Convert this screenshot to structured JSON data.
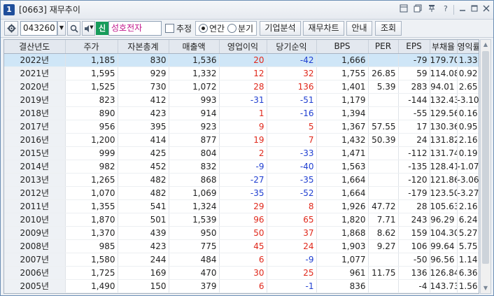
{
  "window": {
    "number": "1",
    "title": "[0663] 재무추이"
  },
  "titlebar_icons": [
    "restore-icon",
    "copy-icon",
    "pin-icon",
    "help-icon",
    "minimize-icon",
    "maximize-icon",
    "close-icon"
  ],
  "toolbar": {
    "code": "043260",
    "market_badge": "신",
    "company_name": "성호전자",
    "estimate_label": "추정",
    "estimate_checked": false,
    "annual_label": "연간",
    "quarter_label": "분기",
    "period_selected": "연간",
    "btn_company_analysis": "기업분석",
    "btn_financial_chart": "재무차트",
    "btn_guide": "안내",
    "btn_search": "조회"
  },
  "table": {
    "headers": [
      "결산년도",
      "주가",
      "자본총계",
      "매출액",
      "영업이익",
      "당기순익",
      "BPS",
      "PER",
      "EPS",
      "부채율",
      "영익률"
    ],
    "selected_row": 0,
    "rows": [
      [
        "2022년",
        "1,185",
        "830",
        "1,536",
        "20",
        "-42",
        "1,666",
        "",
        "-79",
        "179.70",
        "1.33"
      ],
      [
        "2021년",
        "1,595",
        "929",
        "1,332",
        "12",
        "32",
        "1,755",
        "26.85",
        "59",
        "114.08",
        "0.92"
      ],
      [
        "2020년",
        "1,525",
        "730",
        "1,072",
        "28",
        "136",
        "1,401",
        "5.39",
        "283",
        "94.01",
        "2.65"
      ],
      [
        "2019년",
        "823",
        "412",
        "993",
        "-31",
        "-51",
        "1,179",
        "",
        "-144",
        "132.43",
        "-3.10"
      ],
      [
        "2018년",
        "890",
        "423",
        "914",
        "1",
        "-16",
        "1,394",
        "",
        "-55",
        "129.56",
        "0.16"
      ],
      [
        "2017년",
        "956",
        "395",
        "923",
        "9",
        "5",
        "1,367",
        "57.55",
        "17",
        "130.36",
        "0.95"
      ],
      [
        "2016년",
        "1,200",
        "414",
        "877",
        "19",
        "7",
        "1,432",
        "50.39",
        "24",
        "131.82",
        "2.16"
      ],
      [
        "2015년",
        "999",
        "425",
        "804",
        "2",
        "-33",
        "1,471",
        "",
        "-112",
        "131.74",
        "0.19"
      ],
      [
        "2014년",
        "982",
        "452",
        "832",
        "-9",
        "-40",
        "1,563",
        "",
        "-135",
        "128.41",
        "-1.07"
      ],
      [
        "2013년",
        "1,265",
        "482",
        "868",
        "-27",
        "-35",
        "1,664",
        "",
        "-120",
        "121.86",
        "-3.06"
      ],
      [
        "2012년",
        "1,070",
        "482",
        "1,069",
        "-35",
        "-52",
        "1,664",
        "",
        "-179",
        "123.50",
        "-3.27"
      ],
      [
        "2011년",
        "1,355",
        "541",
        "1,324",
        "29",
        "8",
        "1,926",
        "47.72",
        "28",
        "105.63",
        "2.16"
      ],
      [
        "2010년",
        "1,870",
        "501",
        "1,539",
        "96",
        "65",
        "1,820",
        "7.71",
        "243",
        "96.29",
        "6.24"
      ],
      [
        "2009년",
        "1,370",
        "439",
        "950",
        "50",
        "37",
        "1,868",
        "8.62",
        "159",
        "104.30",
        "5.27"
      ],
      [
        "2008년",
        "985",
        "423",
        "775",
        "45",
        "24",
        "1,903",
        "9.27",
        "106",
        "99.64",
        "5.75"
      ],
      [
        "2007년",
        "1,580",
        "244",
        "484",
        "6",
        "-9",
        "1,077",
        "",
        "-50",
        "96.56",
        "1.14"
      ],
      [
        "2006년",
        "1,725",
        "169",
        "470",
        "30",
        "25",
        "961",
        "11.75",
        "136",
        "126.84",
        "6.36"
      ],
      [
        "2005년",
        "1,490",
        "150",
        "379",
        "6",
        "-1",
        "836",
        "",
        "-4",
        "143.73",
        "1.56"
      ]
    ]
  },
  "colors": {
    "positive": "#e0281b",
    "negative": "#1f3fd1",
    "selected_row": "#cfe6f7",
    "market_badge": "#179c5b",
    "company_name": "#c0168c"
  }
}
